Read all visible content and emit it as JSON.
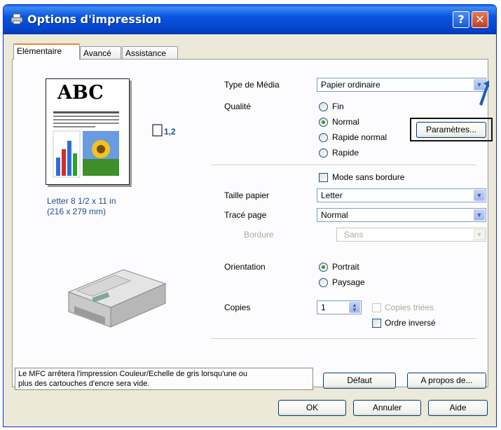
{
  "window": {
    "title": "Options d'impression",
    "help_glyph": "?",
    "close_glyph": "✕"
  },
  "tabs": [
    {
      "label": "Elémentaire",
      "selected": true
    },
    {
      "label": "Avancé",
      "selected": false
    },
    {
      "label": "Assistance",
      "selected": false
    }
  ],
  "preview": {
    "doc_title": "ABC",
    "copies_indicator": "1,2",
    "paper_size_line1": "Letter 8 1/2 x 11 in",
    "paper_size_line2": "(216 x 279 mm)"
  },
  "settings": {
    "media_type": {
      "label": "Type de Média",
      "value": "Papier ordinaire"
    },
    "quality": {
      "label": "Qualité",
      "options": [
        {
          "label": "Fin",
          "selected": false
        },
        {
          "label": "Normal",
          "selected": true
        },
        {
          "label": "Rapide normal",
          "selected": false
        },
        {
          "label": "Rapide",
          "selected": false
        }
      ],
      "params_button": "Paramètres..."
    },
    "borderless": {
      "label": "Mode sans bordure",
      "checked": false
    },
    "paper_size": {
      "label": "Taille papier",
      "value": "Letter"
    },
    "page_layout": {
      "label": "Tracé page",
      "value": "Normal"
    },
    "border": {
      "label": "Bordure",
      "value": "Sans",
      "disabled": true
    },
    "orientation": {
      "label": "Orientation",
      "options": [
        {
          "label": "Portrait",
          "selected": true
        },
        {
          "label": "Paysage",
          "selected": false
        }
      ]
    },
    "copies": {
      "label": "Copies",
      "value": "1",
      "collate": {
        "label": "Copies triées",
        "checked": false,
        "disabled": true
      },
      "reverse": {
        "label": "Ordre inversé",
        "checked": false
      }
    }
  },
  "info_message_line1": "Le MFC arrêtera l'impression Couleur/Echelle de gris lorsqu'une ou",
  "info_message_line2": "plus des cartouches d'encre sera vide.",
  "buttons": {
    "default": "Défaut",
    "about": "A propos de...",
    "ok": "OK",
    "cancel": "Annuler",
    "help": "Aide"
  },
  "colors": {
    "titlebar": "#0A5FE8",
    "dialog_bg": "#ECE9D8",
    "tab_highlight": "#E68B2C",
    "callout_arrow": "#1F5FB4",
    "link_text": "#1F4C8F"
  }
}
